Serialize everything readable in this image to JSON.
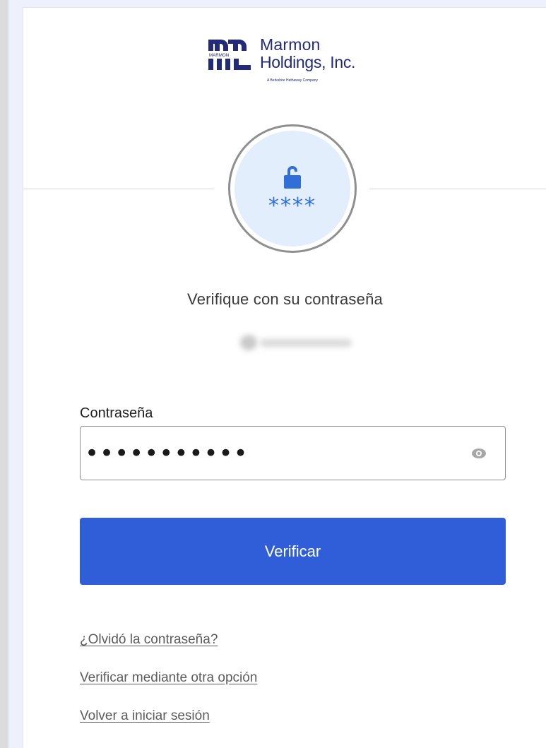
{
  "logo": {
    "mark_text": "MARMON",
    "line1": "Marmon",
    "line2": "Holdings, Inc.",
    "tagline": "A Berkshire Hathaway Company",
    "color": "#232a7a"
  },
  "badge": {
    "icon": "lock-open-icon",
    "stars": "****",
    "color": "#2f6fd6"
  },
  "title": "Verifique con su contraseña",
  "password": {
    "label": "Contraseña",
    "value": "•••••••••••",
    "reveal_icon": "eye-icon"
  },
  "verify_button": {
    "label": "Verificar",
    "color": "#305ed8"
  },
  "links": {
    "forgot": "¿Olvidó la contraseña?",
    "other_option": "Verificar mediante otra opción",
    "back": "Volver a iniciar sesión"
  }
}
